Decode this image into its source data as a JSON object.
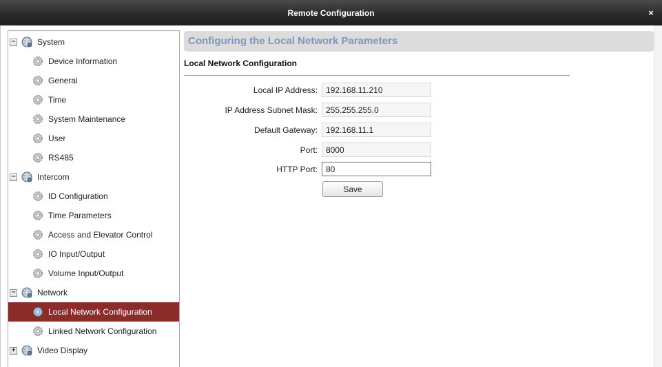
{
  "window": {
    "title": "Remote Configuration",
    "close_glyph": "×"
  },
  "tree": {
    "groups": [
      {
        "label": "System",
        "expanded": true,
        "expander": "−",
        "items": [
          "Device Information",
          "General",
          "Time",
          "System Maintenance",
          "User",
          "RS485"
        ]
      },
      {
        "label": "Intercom",
        "expanded": true,
        "expander": "−",
        "items": [
          "ID Configuration",
          "Time Parameters",
          "Access and Elevator Control",
          "IO Input/Output",
          "Volume Input/Output"
        ]
      },
      {
        "label": "Network",
        "expanded": true,
        "expander": "−",
        "items": [
          "Local Network Configuration",
          "Linked Network Configuration"
        ]
      },
      {
        "label": "Video Display",
        "expanded": false,
        "expander": "+",
        "items": []
      }
    ],
    "selected_item": "Local Network Configuration",
    "selected_color": "#8b2b2a"
  },
  "main": {
    "header": "Configuring the Local Network Parameters",
    "header_color": "#7b97bf",
    "section_title": "Local Network Configuration",
    "fields": [
      {
        "label": "Local IP Address:",
        "value": "192.168.11.210"
      },
      {
        "label": "IP Address Subnet Mask:",
        "value": "255.255.255.0"
      },
      {
        "label": "Default Gateway:",
        "value": "192.168.11.1"
      },
      {
        "label": "Port:",
        "value": "8000"
      },
      {
        "label": "HTTP Port:",
        "value": "80"
      }
    ],
    "save_label": "Save"
  }
}
